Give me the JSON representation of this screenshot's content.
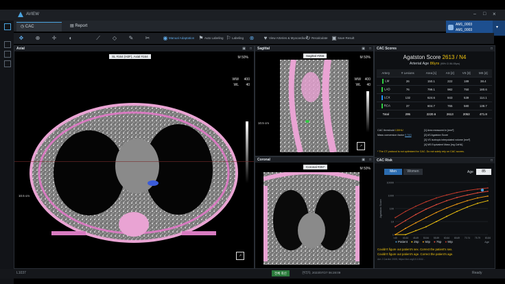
{
  "app": {
    "title": "AVIEW"
  },
  "tabs": [
    {
      "label": "CAC"
    },
    {
      "label": "Report"
    }
  ],
  "user": {
    "line1": "AM1_0003",
    "line2": "AM1_0003"
  },
  "toolbar": {
    "manual_adaptation": "Manual Adaptation",
    "auto_labeling": "Auto Labeling",
    "labeling": "Labeling",
    "view_arteries": "View Arteries & Myocardium",
    "recalculate": "Recalculate",
    "save_result": "Save Result"
  },
  "axial": {
    "title": "Axial",
    "slice_tag": "SL #164 (H2F), Axial #164",
    "orientation": "M 50%",
    "ww_label": "WW",
    "ww": "400",
    "wl_label": "WL",
    "wl": "40",
    "scale_label": "10.5 cm"
  },
  "sagittal": {
    "title": "Sagittal",
    "tag": "Sagittal #256",
    "orientation": "M 50%",
    "ww_label": "WW",
    "ww": "400",
    "wl_label": "WL",
    "wl": "40",
    "scale_label": "10.5 cm"
  },
  "coronal": {
    "title": "Coronal",
    "tag": "Coronal #257",
    "orientation": "M 50%"
  },
  "cac_scores": {
    "panel_title": "CAC Scores",
    "agatston_label": "Agatston Score",
    "agatston_value": "2613 / N4",
    "arterial_age_label": "Arterial Age",
    "arterial_age_value": "86yrs",
    "arterial_age_ci": "(95% CI 86-93yrs)",
    "headers": [
      "Artery",
      "# Lesions",
      "Area [1]",
      "AS [2]",
      "VS [3]",
      "MS [4]"
    ],
    "rows": [
      {
        "name": "LM",
        "color": "#2ecc40",
        "cells": [
          "26",
          "150.1",
          "222",
          "189",
          "38.4"
        ]
      },
      {
        "name": "LAD",
        "color": "#2ecc40",
        "cells": [
          "76",
          "799.1",
          "982",
          "750",
          "180.6"
        ]
      },
      {
        "name": "LCX",
        "color": "#1e90ff",
        "cells": [
          "132",
          "624.6",
          "843",
          "539",
          "114.1"
        ]
      },
      {
        "name": "RCA",
        "color": "#2ecc40",
        "cells": [
          "37",
          "604.7",
          "765",
          "580",
          "138.7"
        ]
      }
    ],
    "total": {
      "name": "Total",
      "cells": [
        "295",
        "2220.6",
        "2613",
        "2053",
        "471.8"
      ]
    },
    "threshold_label": "CAC threshold",
    "threshold_value": "130HU",
    "mass_factor_label": "Mass conversion factor",
    "mass_factor_value": "0.743",
    "notes": [
      "[1] Area measured in [mm²]",
      "[2] AS Agatston Score",
      "[3] VS Isotropic interpolated volume [mm³]",
      "[4] MS Equivalent Mass [mg CaHA]"
    ],
    "warning": "* The CT protocol is not optimized for CAC. Do not solely rely on CAC scores."
  },
  "cac_risk": {
    "panel_title": "CAC Risk",
    "men_label": "Men",
    "women_label": "Women",
    "age_label": "Age",
    "age_value": "85",
    "ylabel": "Agatston Score",
    "legend": [
      {
        "label": "Patient",
        "color": "#4aa3df"
      },
      {
        "label": "25p",
        "color": "#f1c40f"
      },
      {
        "label": "50p",
        "color": "#f39c12"
      },
      {
        "label": "75p",
        "color": "#e74c3c"
      },
      {
        "label": "90p",
        "color": "#c0392b"
      }
    ],
    "messages": [
      "Couldn't figure out patient's sex. Correct the patient's sex.",
      "Couldn't figure out patient's age. Correct the patient's age."
    ],
    "reference": "Am J Cardiol 2005; https://doi.org/10.1016/..."
  },
  "chart_data": {
    "type": "line",
    "x": [
      "<40",
      "40-44",
      "45-49",
      "50-54",
      "55-59",
      "60-64",
      "65-69",
      "70-74",
      "75-79",
      "80-84"
    ],
    "xlabel": "Age",
    "ylabel": "Agatston Score",
    "yscale": "log",
    "yticks": [
      "1",
      "10",
      "100",
      "1000",
      "10000"
    ],
    "series": [
      {
        "name": "25p",
        "values": [
          1,
          1,
          2,
          4,
          10,
          25,
          60,
          130,
          250,
          400
        ]
      },
      {
        "name": "50p",
        "values": [
          1,
          3,
          8,
          20,
          50,
          110,
          220,
          400,
          650,
          900
        ]
      },
      {
        "name": "75p",
        "values": [
          4,
          12,
          35,
          90,
          200,
          400,
          700,
          1100,
          1600,
          2100
        ]
      },
      {
        "name": "90p",
        "values": [
          20,
          60,
          150,
          330,
          650,
          1100,
          1700,
          2400,
          3100,
          3800
        ]
      }
    ],
    "patient": {
      "x": "80-84",
      "y": 2613
    }
  },
  "statusbar": {
    "left": "L1037",
    "center_btn": "전체 최신",
    "center": "관리자, 2023/07/27 06:28:09",
    "right": "Ready"
  }
}
